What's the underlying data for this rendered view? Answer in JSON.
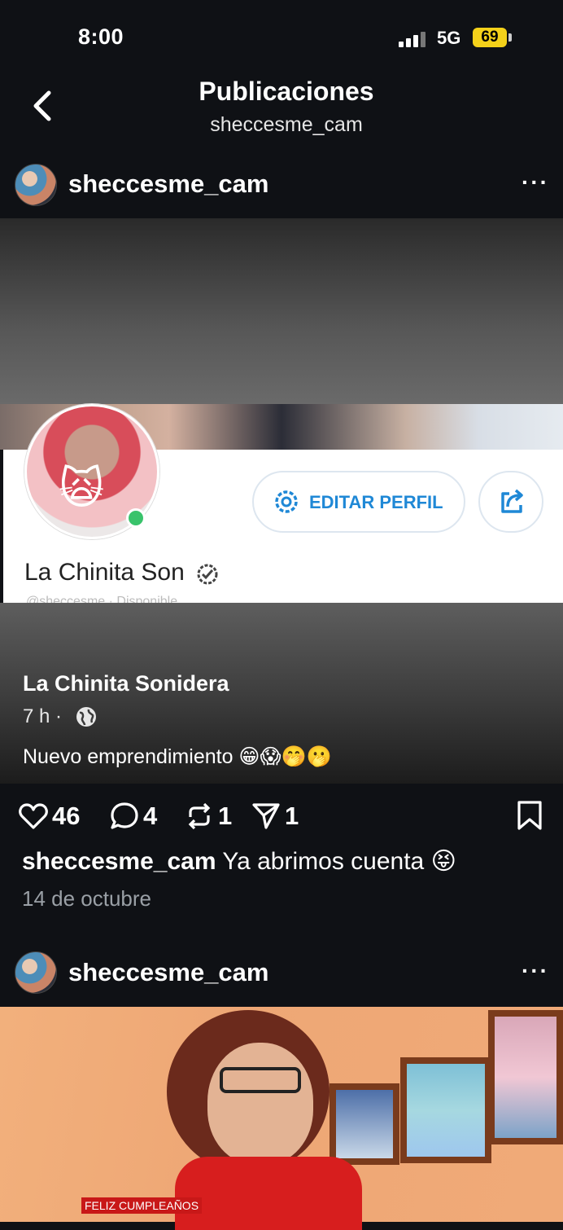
{
  "status_bar": {
    "time": "8:00",
    "network": "5G",
    "battery": "69"
  },
  "header": {
    "title": "Publicaciones",
    "subtitle": "sheccesme_cam"
  },
  "post1": {
    "username": "sheccesme_cam",
    "more": "···",
    "screenshot": {
      "edit_button": "EDITAR PERFIL",
      "profile_name": "La Chinita Son",
      "profile_sub": "@sheccesme · Disponible",
      "author": "La Chinita Sonidera",
      "time": "7 h ·",
      "text": "Nuevo emprendimiento 😁😱🤭🫢"
    },
    "actions": {
      "likes": "46",
      "comments": "4",
      "reposts": "1",
      "shares": "1"
    },
    "caption_user": "sheccesme_cam",
    "caption_text": " Ya abrimos cuenta 😝",
    "date": "14 de octubre"
  },
  "post2": {
    "username": "sheccesme_cam",
    "more": "···",
    "sign": "FELIZ CUMPLEAÑOS"
  },
  "colors": {
    "background": "#0f1115",
    "accent_blue": "#1f88d6",
    "battery": "#f4d11a",
    "online": "#39c36b"
  }
}
